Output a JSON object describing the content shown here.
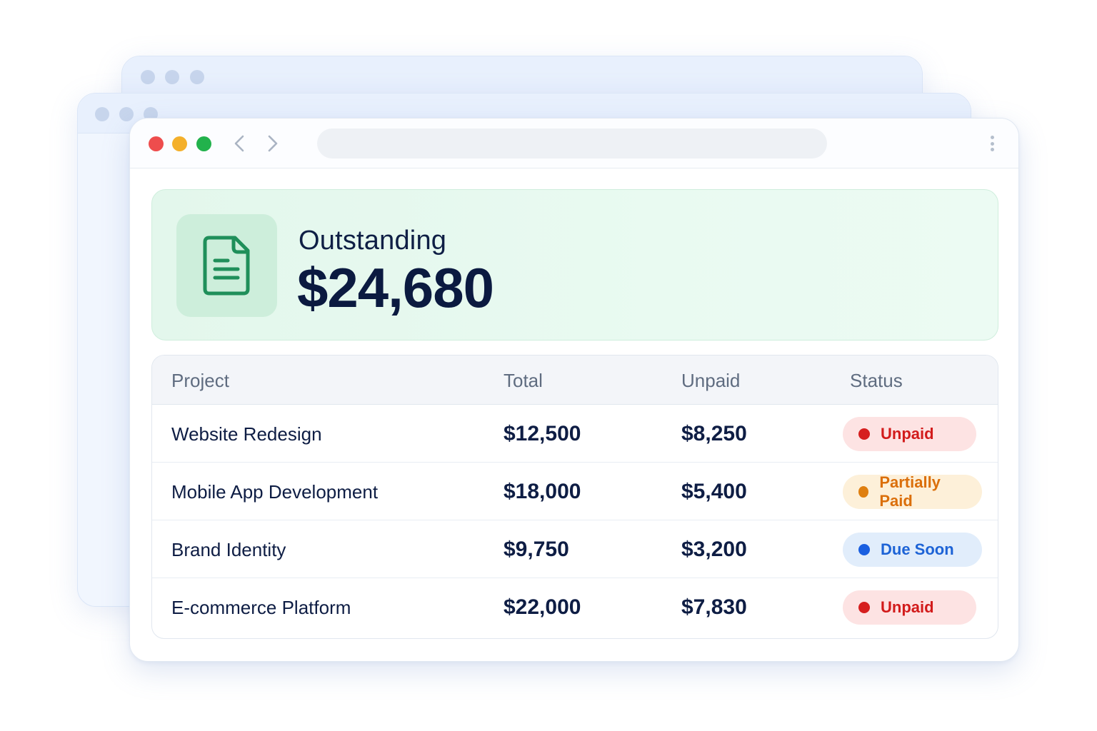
{
  "summary": {
    "label": "Outstanding",
    "amount": "$24,680",
    "icon": "document-icon"
  },
  "table": {
    "headers": {
      "project": "Project",
      "total": "Total",
      "unpaid": "Unpaid",
      "status": "Status"
    },
    "rows": [
      {
        "project": "Website Redesign",
        "total": "$12,500",
        "unpaid": "$8,250",
        "status": "Unpaid"
      },
      {
        "project": "Mobile App Development",
        "total": "$18,000",
        "unpaid": "$5,400",
        "status": "Partially Paid"
      },
      {
        "project": "Brand Identity",
        "total": "$9,750",
        "unpaid": "$3,200",
        "status": "Due Soon"
      },
      {
        "project": "E-commerce Platform",
        "total": "$22,000",
        "unpaid": "$7,830",
        "status": "Unpaid"
      }
    ]
  },
  "colors": {
    "unpaid": "#d21b1b",
    "partially_paid": "#db6f0b",
    "due_soon": "#1d63d6",
    "accent_green": "#1f8f5a"
  }
}
